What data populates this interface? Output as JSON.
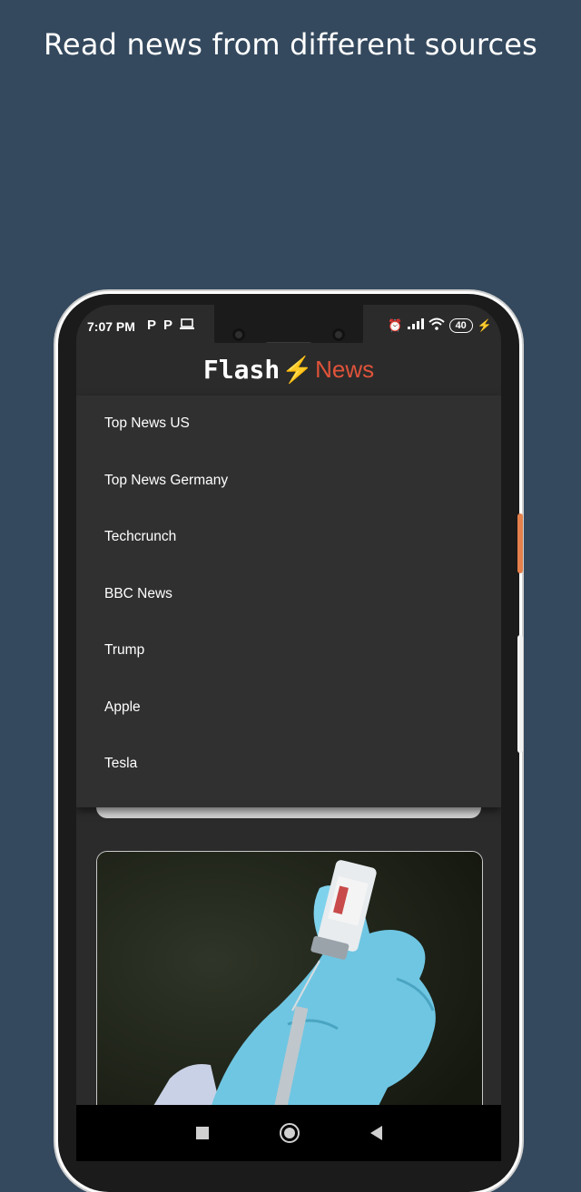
{
  "headline": "Read news from different sources",
  "status": {
    "time": "7:07 PM",
    "left_icons": [
      "P",
      "P",
      "laptop"
    ],
    "battery": "40"
  },
  "app": {
    "logo_flash": "Flash",
    "logo_news": "News"
  },
  "menu": {
    "items": [
      {
        "label": "Top News US"
      },
      {
        "label": "Top News Germany"
      },
      {
        "label": "Techcrunch"
      },
      {
        "label": "BBC News"
      },
      {
        "label": "Trump"
      },
      {
        "label": "Apple"
      },
      {
        "label": "Tesla"
      }
    ]
  },
  "card": {
    "image": "vaccine-vial-gloved-hand"
  },
  "colors": {
    "background": "#34495e",
    "accent_news": "#e0533a",
    "bolt": "#f5c518"
  }
}
